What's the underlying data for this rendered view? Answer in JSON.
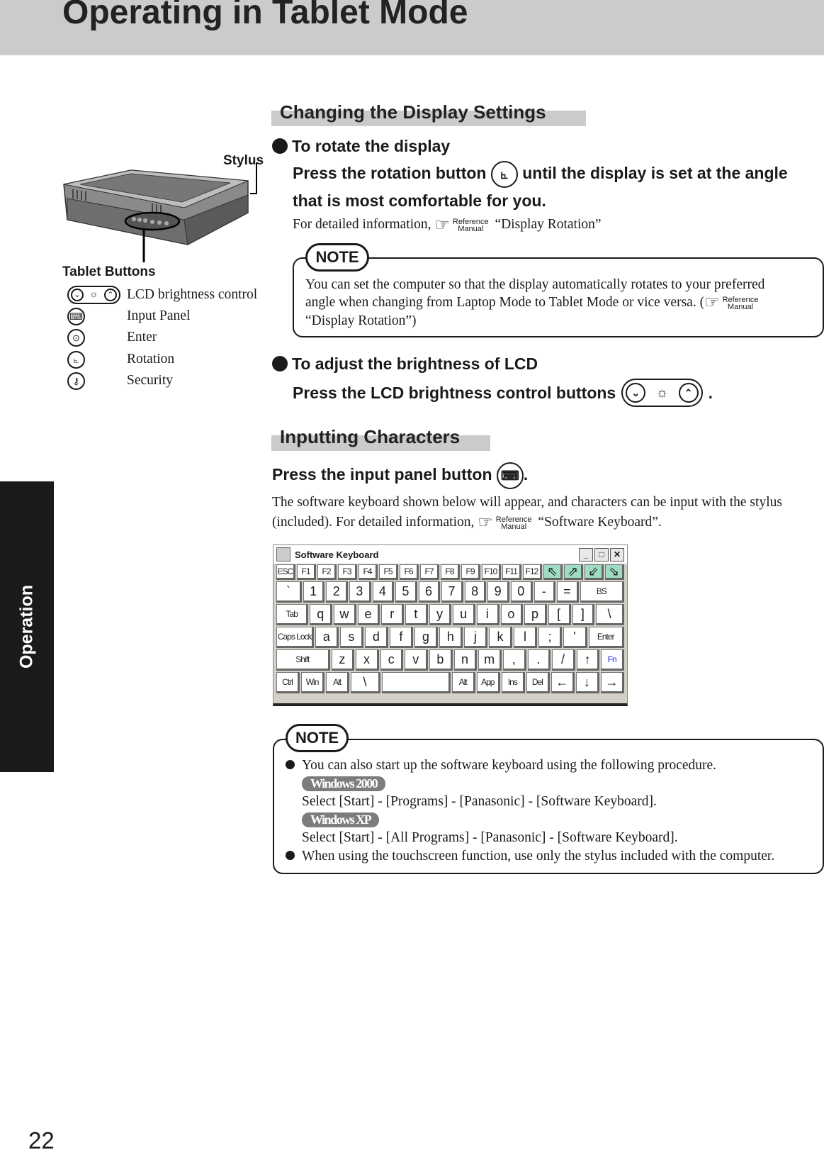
{
  "header": {
    "title": "Operating in Tablet Mode"
  },
  "side_tab": {
    "label": "Operation"
  },
  "page_number": "22",
  "figure": {
    "stylus_label": "Stylus",
    "tablet_buttons_label": "Tablet Buttons"
  },
  "tablet_buttons": [
    {
      "icon": "brightness-icon",
      "label": "LCD brightness control"
    },
    {
      "icon": "keyboard-icon",
      "label": "Input Panel"
    },
    {
      "icon": "enter-icon",
      "label": "Enter"
    },
    {
      "icon": "rotation-icon",
      "label": "Rotation"
    },
    {
      "icon": "key-icon",
      "label": "Security"
    }
  ],
  "display_settings": {
    "heading": "Changing the Display Settings",
    "rotate": {
      "title": "To rotate the display",
      "line1a": "Press the rotation button",
      "line1b": "until the display is set at the angle",
      "line2": "that is most comfortable for you.",
      "detail": "For detailed information,",
      "detail_ref": "“Display Rotation”"
    },
    "note": {
      "label": "NOTE",
      "line1": "You can set the computer so that the display automatically rotates to your preferred",
      "line2": "angle when changing from Laptop Mode to Tablet Mode or vice versa.  (",
      "line3": "“Display Rotation”)"
    },
    "brightness": {
      "title": "To adjust the brightness of LCD",
      "line": "Press the LCD brightness control buttons",
      "end": "."
    }
  },
  "reference": {
    "top": "Reference",
    "bottom": "Manual"
  },
  "inputting": {
    "heading": "Inputting Characters",
    "press": "Press the input panel button",
    "press_end": ".",
    "para1": "The software keyboard shown below will appear, and characters can be input with the stylus",
    "para2": "(included).  For detailed information,",
    "para2_ref": "“Software Keyboard”."
  },
  "keyboard": {
    "title": "Software Keyboard",
    "rows": [
      [
        "ESC",
        "F1",
        "F2",
        "F3",
        "F4",
        "F5",
        "F6",
        "F7",
        "F8",
        "F9",
        "F10",
        "F11",
        "F12",
        "⇖",
        "⇗",
        "⇙",
        "⇘"
      ],
      [
        "`",
        "1",
        "2",
        "3",
        "4",
        "5",
        "6",
        "7",
        "8",
        "9",
        "0",
        "-",
        "=",
        "BS"
      ],
      [
        "Tab",
        "q",
        "w",
        "e",
        "r",
        "t",
        "y",
        "u",
        "i",
        "o",
        "p",
        "[",
        "]",
        "\\"
      ],
      [
        "Caps Lock",
        "a",
        "s",
        "d",
        "f",
        "g",
        "h",
        "j",
        "k",
        "l",
        ";",
        "'",
        "Enter"
      ],
      [
        "Shift",
        "z",
        "x",
        "c",
        "v",
        "b",
        "n",
        "m",
        ",",
        ".",
        "/",
        "↑",
        "Fn"
      ],
      [
        "Ctrl",
        "Win",
        "Alt",
        "\\",
        "",
        "Alt",
        "App",
        "Ins",
        "Del",
        "←",
        "↓",
        "→"
      ]
    ],
    "accent_green": "#9edcc3",
    "accent_blue": "#2222dd"
  },
  "note2": {
    "label": "NOTE",
    "item1": "You can also start up the software keyboard using the following procedure.",
    "os1": "Windows 2000",
    "os1_path": "Select [Start] - [Programs] - [Panasonic] - [Software Keyboard].",
    "os2": "Windows XP",
    "os2_path": "Select [Start] - [All Programs] - [Panasonic] - [Software Keyboard].",
    "item2": "When using the touchscreen function, use only the stylus included with the computer."
  }
}
